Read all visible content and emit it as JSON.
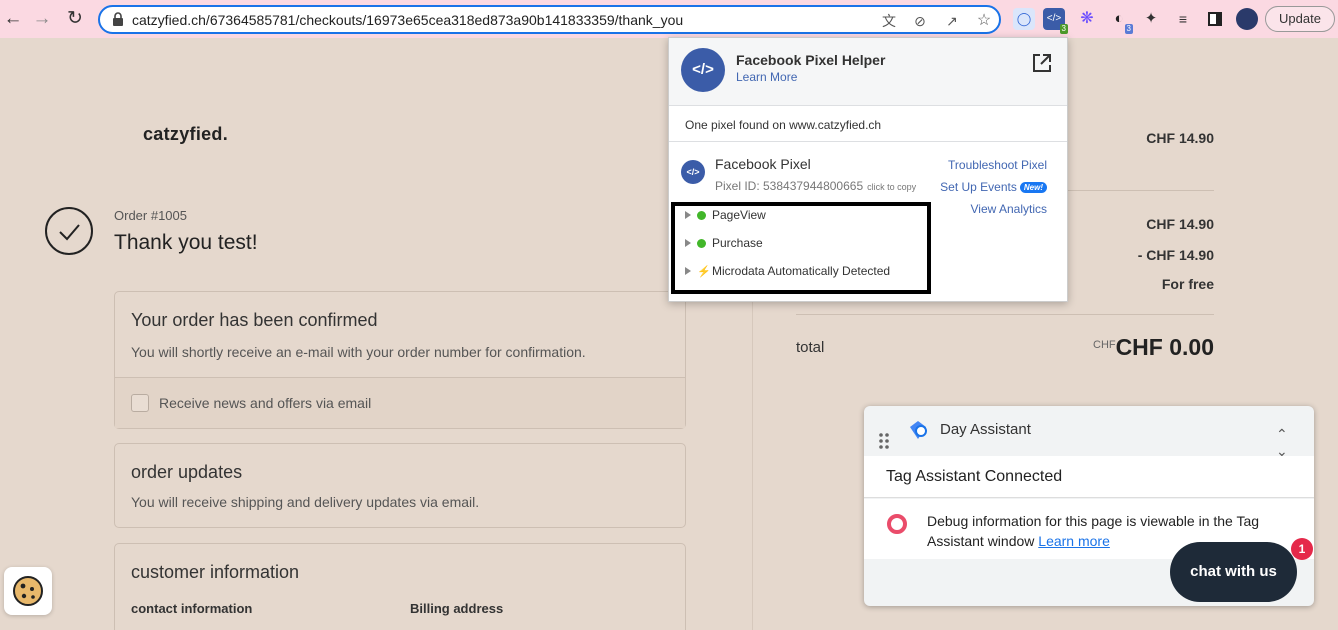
{
  "browser": {
    "url": "catzyfied.ch/67364585781/checkouts/16973e65cea318ed873a90b141833359/thank_you",
    "update_label": "Update",
    "icons": [
      "back-icon",
      "forward-icon",
      "reload-icon",
      "lock-icon",
      "translate-icon",
      "eye-off-icon",
      "share-icon",
      "star-icon"
    ],
    "extensions": [
      {
        "name": "tag-assistant-icon",
        "badge": ""
      },
      {
        "name": "pixel-helper-icon",
        "badge": "3"
      },
      {
        "name": "asterisk-icon",
        "badge": ""
      },
      {
        "name": "analytics-icon",
        "badge": "3"
      },
      {
        "name": "puzzle-icon",
        "badge": ""
      }
    ]
  },
  "shop": {
    "logo": "catzyfied.",
    "order_number": "Order #1005",
    "thanks": "Thank you test!"
  },
  "confirmed_box": {
    "title": "Your order has been confirmed",
    "text": "You will shortly receive an e-mail with your order number for confirmation.",
    "checkbox_label": "Receive news and offers via email"
  },
  "updates_box": {
    "title": "order updates",
    "text": "You will receive shipping and delivery updates via email."
  },
  "customer_box": {
    "title": "customer information",
    "contact_head": "contact information",
    "billing_head": "Billing address"
  },
  "summary": {
    "subtotal_top": "CHF 14.90",
    "subtotal": "CHF 14.90",
    "discount": "- CHF 14.90",
    "shipping": "For free",
    "total_label": "total",
    "total_currency": "CHF",
    "total_value": "CHF 0.00"
  },
  "pixel_helper": {
    "title": "Facebook Pixel Helper",
    "learn_more": "Learn More",
    "found_text": "One pixel found on www.catzyfied.ch",
    "pixel_name": "Facebook Pixel",
    "pixel_id": "Pixel ID: 538437944800665",
    "click_to_copy": "click to copy",
    "links": {
      "troubleshoot": "Troubleshoot Pixel",
      "setup_events": "Set Up Events",
      "new_badge": "New!",
      "view_analytics": "View Analytics"
    },
    "events": [
      {
        "label": "PageView",
        "status": "ok"
      },
      {
        "label": "Purchase",
        "status": "ok"
      },
      {
        "label": "Microdata Automatically Detected",
        "status": "auto"
      }
    ]
  },
  "day_assistant": {
    "title": "Day Assistant",
    "status": "Tag Assistant Connected",
    "info_text": "Debug information for this page is viewable in the Tag Assistant window",
    "learn_more": "Learn more"
  },
  "chat": {
    "label": "chat with us",
    "badge": "1"
  },
  "colors": {
    "page_bg": "#e5d8cd",
    "browser_bar": "#fbd9e2",
    "fb_blue": "#3b5ca8",
    "link_blue": "#4267b2",
    "ok_green": "#42b72a",
    "chat_bg": "#1e2a38",
    "badge_red": "#e5294a"
  }
}
